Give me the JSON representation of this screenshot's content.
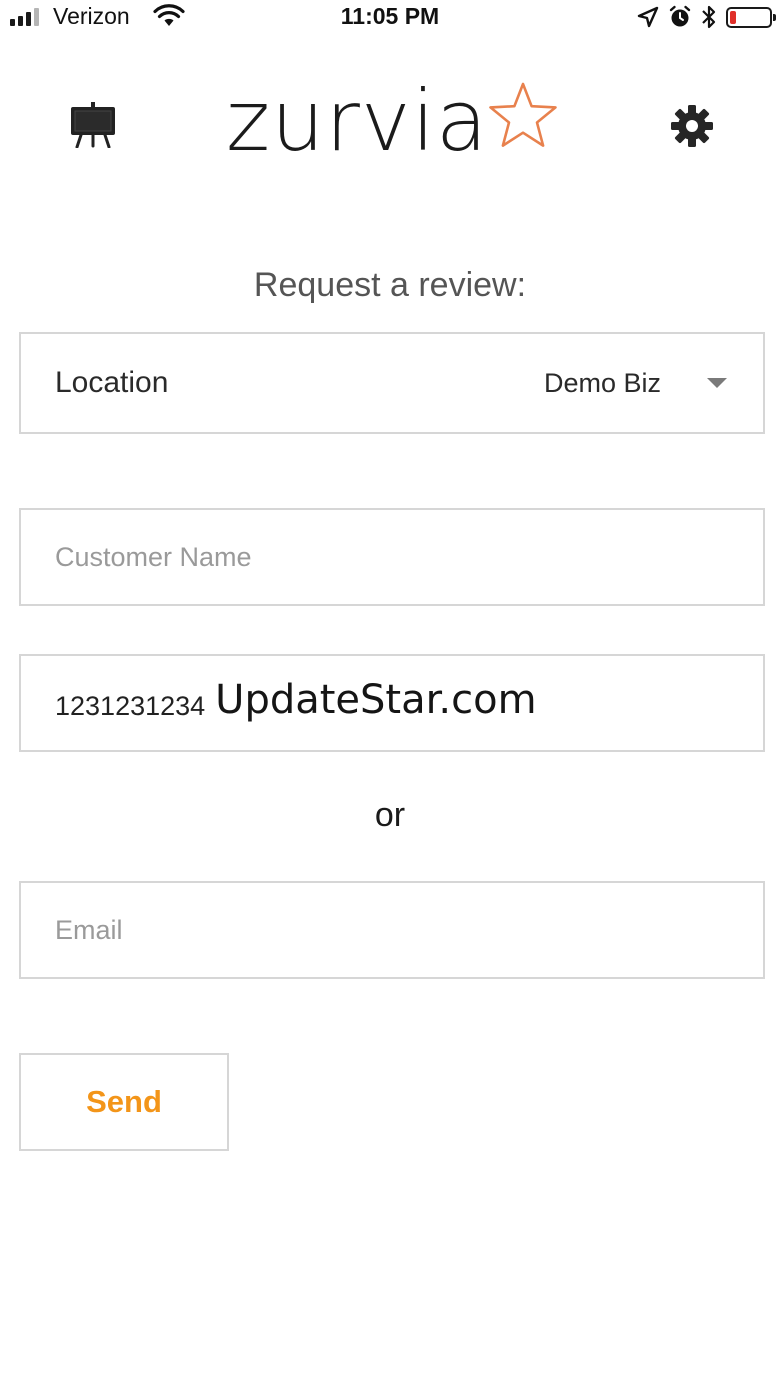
{
  "status_bar": {
    "carrier": "Verizon",
    "time": "11:05 PM",
    "signal_bars_filled": 3,
    "signal_bars_total": 4,
    "battery_level": 0.15,
    "icons": [
      "wifi-icon",
      "location-arrow-icon",
      "alarm-icon",
      "bluetooth-icon",
      "battery-icon"
    ]
  },
  "header": {
    "logo_text": "zurvia",
    "logo_star_color": "#e8814d",
    "left_icon": "presentation-easel-icon",
    "right_icon": "gear-icon"
  },
  "form": {
    "title": "Request a review:",
    "location": {
      "label": "Location",
      "value": "Demo Biz"
    },
    "customer_name": {
      "placeholder": "Customer Name",
      "value": ""
    },
    "phone": {
      "value": "1231231234"
    },
    "divider": "or",
    "email": {
      "placeholder": "Email",
      "value": ""
    },
    "send_label": "Send"
  },
  "watermark": "UpdateStar.com",
  "colors": {
    "accent": "#f39519",
    "border": "#d6d6d6",
    "battery_low": "#e0302a"
  }
}
